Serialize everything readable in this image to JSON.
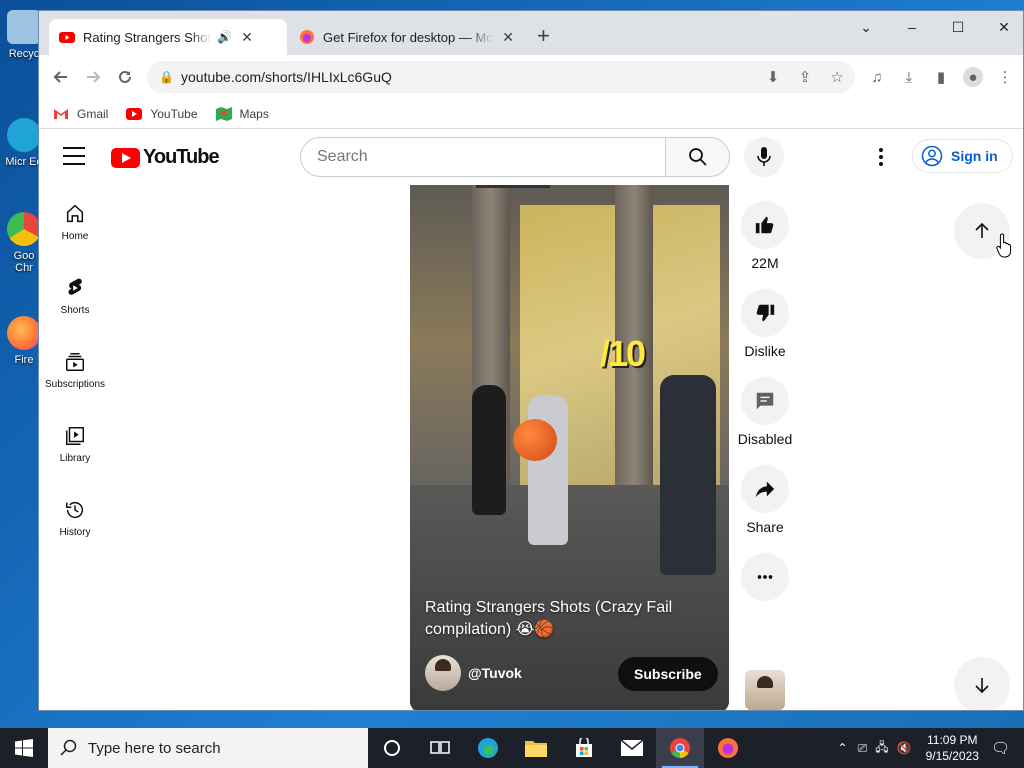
{
  "desktop": {
    "icons": [
      {
        "label": "Recyc",
        "color": "#9fc2e0"
      },
      {
        "label": "Micr Ed",
        "color": "#1fa4d6"
      },
      {
        "label": "Goo Chr",
        "color": "#e8453c"
      },
      {
        "label": "Fire",
        "color": "#ff7139"
      }
    ]
  },
  "browser": {
    "tabs": [
      {
        "title": "Rating Strangers Shots (Crazy Fail compilation)",
        "active": true,
        "audio_icon": "speaker-icon"
      },
      {
        "title": "Get Firefox for desktop — Mozilla",
        "active": false
      }
    ],
    "new_tab": "+",
    "window_controls": {
      "dropdown": "⌄",
      "minimize": "–",
      "maximize": "☐",
      "close": "✕"
    },
    "url": "youtube.com/shorts/IHLIxLc6GuQ",
    "bookmarks": [
      "Gmail",
      "YouTube",
      "Maps"
    ]
  },
  "youtube": {
    "logo_text": "YouTube",
    "search_placeholder": "Search",
    "sign_in": "Sign in",
    "sidebar": [
      {
        "label": "Home",
        "icon": "home-icon"
      },
      {
        "label": "Shorts",
        "icon": "shorts-icon"
      },
      {
        "label": "Subscriptions",
        "icon": "subscriptions-icon"
      },
      {
        "label": "Library",
        "icon": "library-icon"
      },
      {
        "label": "History",
        "icon": "history-icon"
      }
    ],
    "short": {
      "overlay_text": "/10",
      "title": "Rating Strangers Shots (Crazy Fail compilation) 😭🏀",
      "channel": "@Tuvok",
      "subscribe": "Subscribe"
    },
    "actions": {
      "like": "22M",
      "dislike": "Dislike",
      "comments": "Disabled",
      "share": "Share"
    }
  },
  "taskbar": {
    "search_placeholder": "Type here to search",
    "time": "11:09 PM",
    "date": "9/15/2023"
  },
  "colors": {
    "yt_red": "#ff0000",
    "link_blue": "#065fd4",
    "taskbar": "#1c2029"
  }
}
